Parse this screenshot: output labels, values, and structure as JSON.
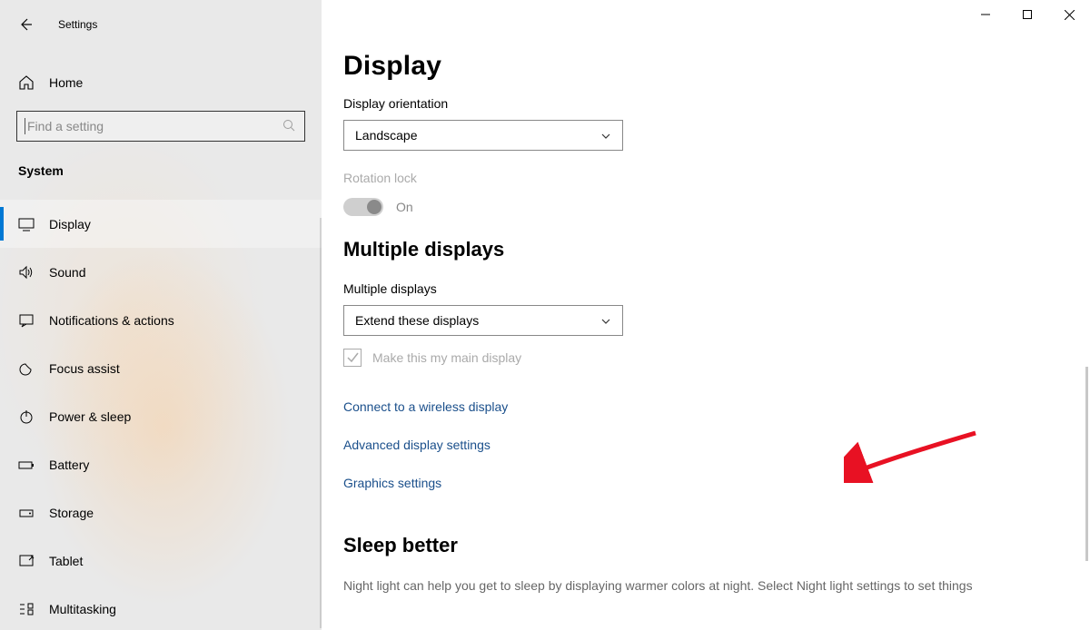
{
  "window": {
    "title": "Settings"
  },
  "sidebar": {
    "home_label": "Home",
    "search_placeholder": "Find a setting",
    "category_label": "System",
    "items": [
      {
        "label": "Display",
        "icon": "display-icon",
        "active": true
      },
      {
        "label": "Sound",
        "icon": "sound-icon"
      },
      {
        "label": "Notifications & actions",
        "icon": "notifications-icon"
      },
      {
        "label": "Focus assist",
        "icon": "focus-icon"
      },
      {
        "label": "Power & sleep",
        "icon": "power-icon"
      },
      {
        "label": "Battery",
        "icon": "battery-icon"
      },
      {
        "label": "Storage",
        "icon": "storage-icon"
      },
      {
        "label": "Tablet",
        "icon": "tablet-icon"
      },
      {
        "label": "Multitasking",
        "icon": "multitasking-icon"
      }
    ]
  },
  "main": {
    "page_title": "Display",
    "orientation_label": "Display orientation",
    "orientation_value": "Landscape",
    "rotation_lock_label": "Rotation lock",
    "rotation_lock_value": "On",
    "multiple_displays_title": "Multiple displays",
    "multiple_displays_label": "Multiple displays",
    "multiple_displays_value": "Extend these displays",
    "main_display_checkbox": "Make this my main display",
    "link_wireless": "Connect to a wireless display",
    "link_advanced": "Advanced display settings",
    "link_graphics": "Graphics settings",
    "sleep_title": "Sleep better",
    "sleep_body": "Night light can help you get to sleep by displaying warmer colors at night. Select Night light settings to set things"
  }
}
